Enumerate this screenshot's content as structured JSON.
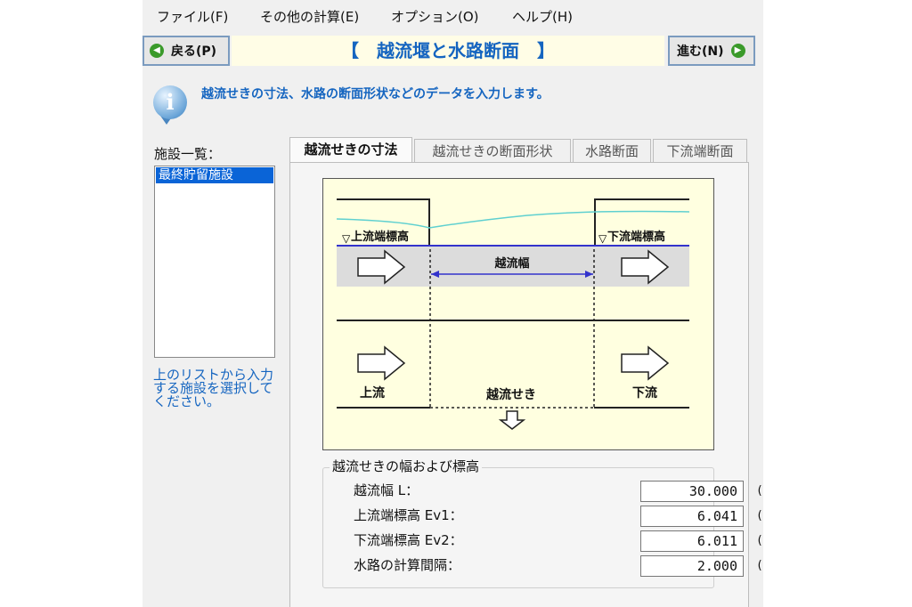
{
  "menu": [
    "ファイル(F)",
    "その他の計算(E)",
    "オプション(O)",
    "ヘルプ(H)"
  ],
  "nav": {
    "back_label": "戻る(P)",
    "title": "【　越流堰と水路断面　】",
    "next_label": "進む(N)"
  },
  "info": "越流せきの寸法、水路の断面形状などのデータを入力します。",
  "facilities": {
    "label": "施設一覧：",
    "items": [
      "最終貯留施設"
    ]
  },
  "hint": "上のリストから入力する施設を選択してください。",
  "tabs": [
    "越流せきの寸法",
    "越流せきの断面形状",
    "水路断面",
    "下流端断面"
  ],
  "diagram": {
    "upstream_elev": "上流端標高",
    "downstream_elev": "下流端標高",
    "weir_width": "越流幅",
    "upstream": "上流",
    "weir": "越流せき",
    "downstream": "下流",
    "background_color": "#ffffe0",
    "water_color": "#5fd0d0",
    "dimension_color": "#3333cc"
  },
  "form": {
    "title": "越流せきの幅および標高",
    "fields": [
      {
        "label": "越流幅 L：",
        "value": "30.000",
        "unit": "(m)"
      },
      {
        "label": "上流端標高 Ev1：",
        "value": "6.041",
        "unit": "(m)"
      },
      {
        "label": "下流端標高 Ev2：",
        "value": "6.011",
        "unit": "(m)"
      },
      {
        "label": "水路の計算間隔：",
        "value": "2.000",
        "unit": "(m)"
      }
    ]
  }
}
